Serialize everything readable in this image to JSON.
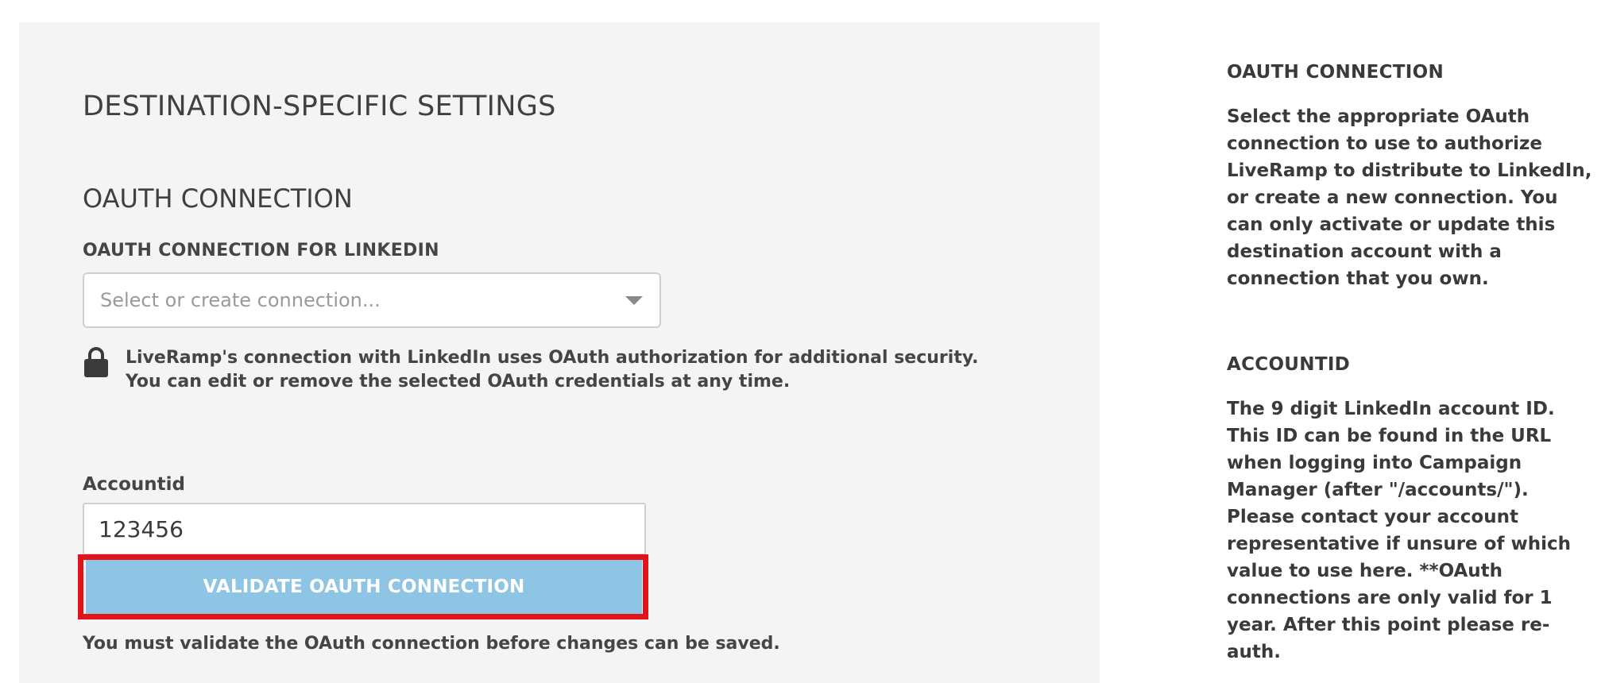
{
  "main": {
    "section_title": "DESTINATION-SPECIFIC SETTINGS",
    "oauth_subtitle": "OAUTH CONNECTION",
    "oauth_field_label": "OAUTH CONNECTION FOR LINKEDIN",
    "oauth_select_placeholder": "Select or create connection...",
    "security_note_line1": "LiveRamp's connection with LinkedIn uses OAuth authorization for additional security.",
    "security_note_line2": "You can edit or remove the selected OAuth credentials at any time.",
    "accountid_label": "Accountid",
    "accountid_value": "123456",
    "validate_button_label": "VALIDATE OAUTH CONNECTION",
    "validate_message": "You must validate the OAuth connection before changes can be saved."
  },
  "help": {
    "oauth_title": "OAUTH CONNECTION",
    "oauth_body": "Select the appropriate OAuth connection to use to authorize LiveRamp to distribute to LinkedIn, or create a new connection. You can only activate or update this destination account with a connection that you own.",
    "accountid_title": "ACCOUNTID",
    "accountid_body": "The 9 digit LinkedIn account ID. This ID can be found in the URL when logging into Campaign Manager (after \"/accounts/\"). Please contact your account representative if unsure of which value to use here. **OAuth connections are only valid for 1 year. After this point please re-auth."
  },
  "colors": {
    "panel_bg": "#f4f4f4",
    "button_bg": "#8fc5e4",
    "highlight_border": "#e2131a"
  },
  "icons": {
    "lock": "lock-icon",
    "dropdown": "chevron-down-icon"
  }
}
